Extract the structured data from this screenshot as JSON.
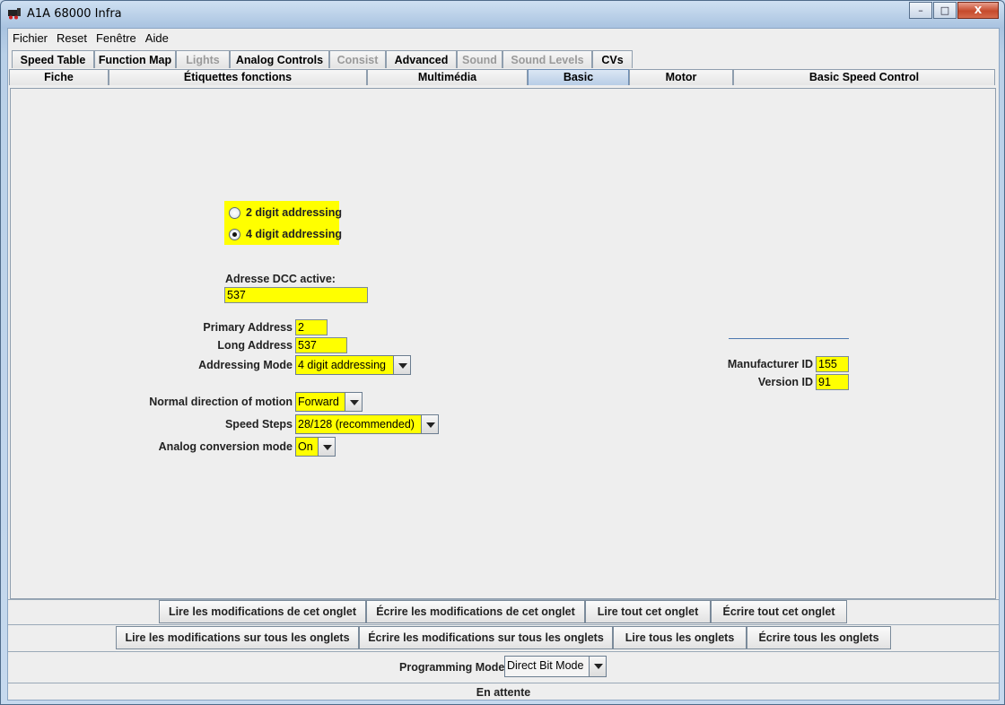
{
  "window": {
    "title": "A1A 68000 Infra",
    "controls": {
      "minimize": "–",
      "maximize": "□",
      "close": "X"
    }
  },
  "menu": [
    "Fichier",
    "Reset",
    "Fenêtre",
    "Aide"
  ],
  "tabs_row1": [
    {
      "label": "Speed Table",
      "enabled": true
    },
    {
      "label": "Function Map",
      "enabled": true
    },
    {
      "label": "Lights",
      "enabled": false
    },
    {
      "label": "Analog Controls",
      "enabled": true
    },
    {
      "label": "Consist",
      "enabled": false
    },
    {
      "label": "Advanced",
      "enabled": true
    },
    {
      "label": "Sound",
      "enabled": false
    },
    {
      "label": "Sound Levels",
      "enabled": false
    },
    {
      "label": "CVs",
      "enabled": true
    }
  ],
  "tabs_row2": [
    {
      "label": "Fiche",
      "selected": false
    },
    {
      "label": "Étiquettes fonctions",
      "selected": false
    },
    {
      "label": "Multimédia",
      "selected": false
    },
    {
      "label": "Basic",
      "selected": true
    },
    {
      "label": "Motor",
      "selected": false
    },
    {
      "label": "Basic Speed Control",
      "selected": false
    }
  ],
  "addressing": {
    "opt2": "2 digit addressing",
    "opt4": "4 digit addressing",
    "selected": "4 digit addressing",
    "dcc_label": "Adresse DCC active:",
    "dcc_value": "537"
  },
  "fields": {
    "primary_label": "Primary Address",
    "primary_value": "2",
    "long_label": "Long Address",
    "long_value": "537",
    "mode_label": "Addressing Mode",
    "mode_value": "4 digit addressing",
    "direction_label": "Normal direction of motion",
    "direction_value": "Forward",
    "steps_label": "Speed Steps",
    "steps_value": "28/128 (recommended)",
    "analog_label": "Analog conversion mode",
    "analog_value": "On",
    "manufacturer_label": "Manufacturer ID",
    "manufacturer_value": "155",
    "version_label": "Version ID",
    "version_value": "91"
  },
  "buttons_tab": [
    "Lire les modifications de cet onglet",
    "Écrire les modifications de cet onglet",
    "Lire tout cet onglet",
    "Écrire tout cet onglet"
  ],
  "buttons_all": [
    "Lire les modifications sur tous les onglets",
    "Écrire les modifications sur tous les onglets",
    "Lire tous les onglets",
    "Écrire tous les onglets"
  ],
  "programming": {
    "label": "Programming Mode",
    "value": "Direct Bit Mode"
  },
  "status": "En attente",
  "colors": {
    "field_highlight": "#ffff00",
    "selected_tab": "#b8cde6"
  }
}
